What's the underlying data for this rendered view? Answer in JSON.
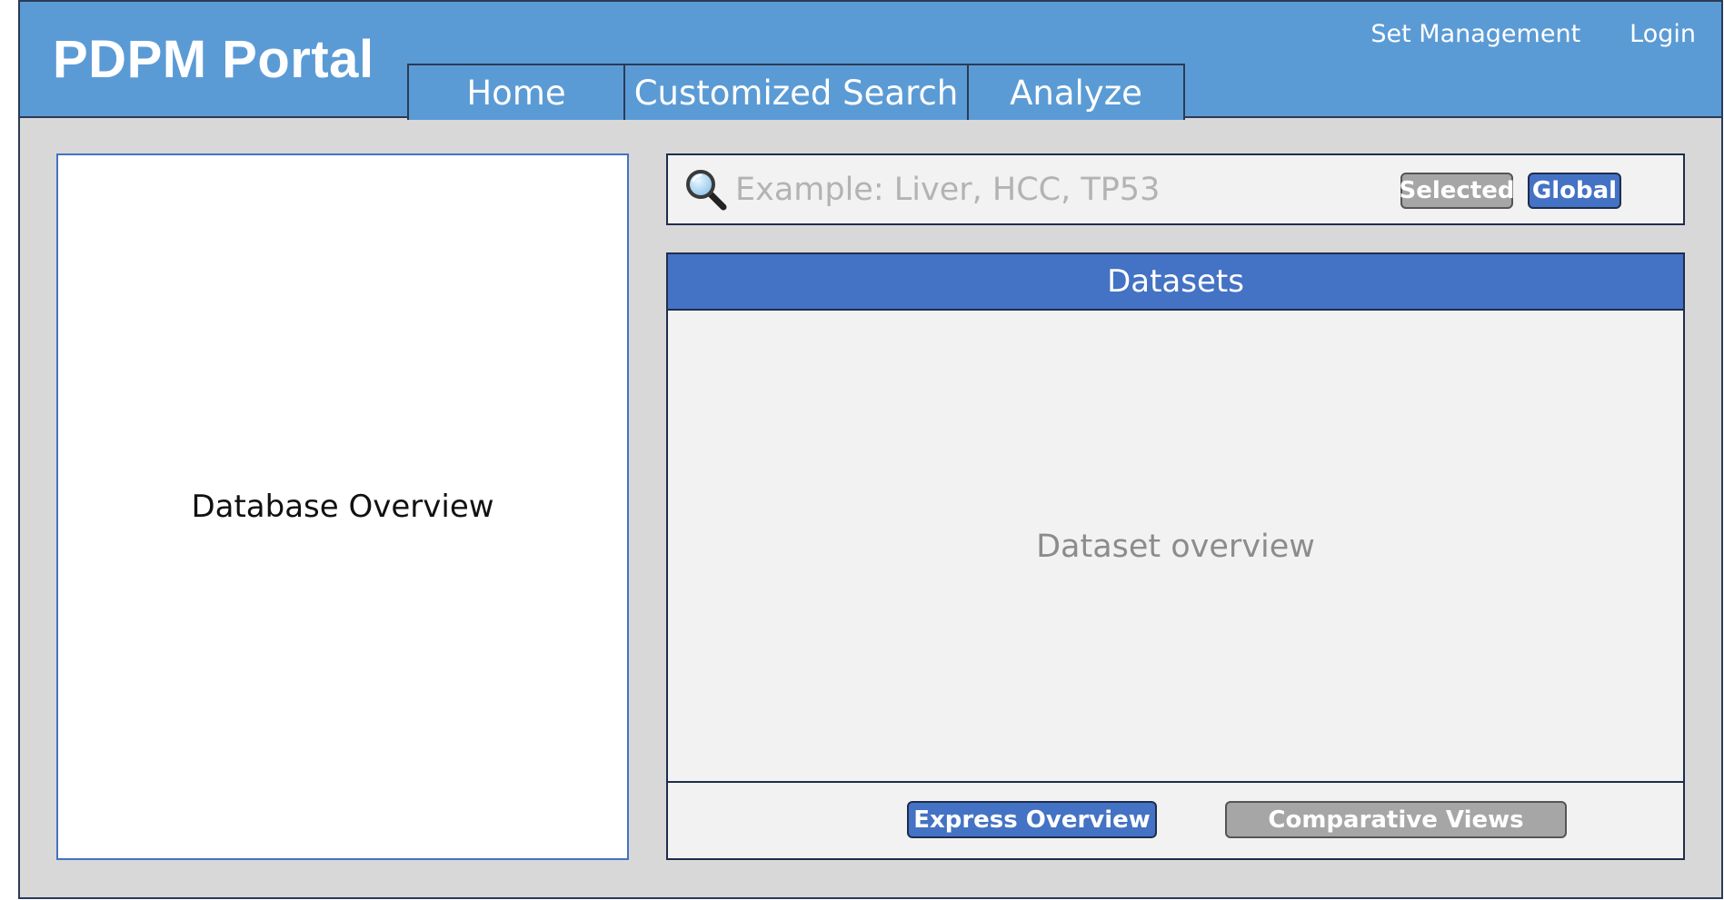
{
  "header": {
    "brand": "PDPM Portal",
    "nav_tabs": [
      {
        "label": "Home"
      },
      {
        "label": "Customized Search"
      },
      {
        "label": "Analyze"
      }
    ],
    "links": {
      "set_management": "Set Management",
      "login": "Login"
    }
  },
  "left_panel": {
    "label": "Database Overview"
  },
  "search": {
    "placeholder": "Example: Liver, HCC, TP53",
    "value": "",
    "scope_selected": "Selected",
    "scope_global": "Global",
    "active_scope": "Global"
  },
  "datasets": {
    "title": "Datasets",
    "body_label": "Dataset overview",
    "buttons": {
      "express_overview": "Express Overview",
      "comparative_views": "Comparative Views"
    }
  },
  "colors": {
    "header_blue": "#5b9bd5",
    "accent_blue": "#4472c4",
    "inactive_gray": "#a6a6a6",
    "frame_gray": "#d8d8d8",
    "border_navy": "#1f2d4d"
  },
  "icons": [
    "search-icon"
  ]
}
